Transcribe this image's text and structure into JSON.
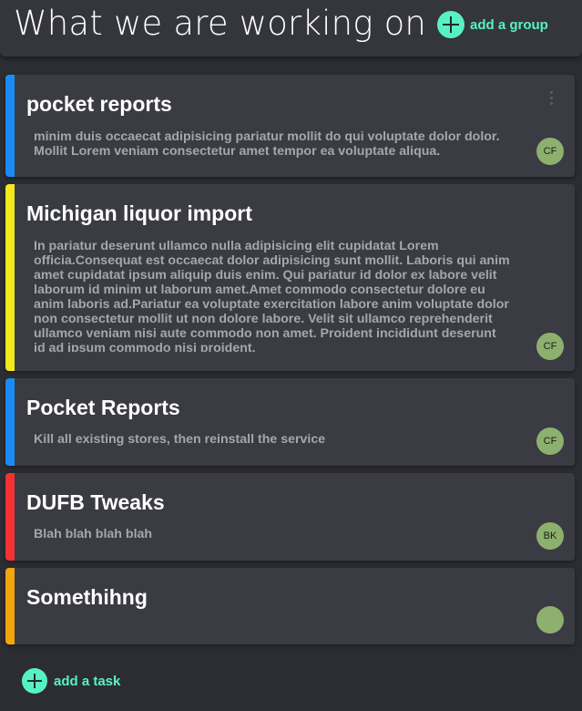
{
  "header": {
    "title": "What we are working on",
    "add_group_label": "add a group"
  },
  "tasks": [
    {
      "title": "pocket reports",
      "description": "minim duis occaecat adipisicing pariatur mollit do qui voluptate dolor dolor. Mollit Lorem veniam consectetur amet tempor ea voluptate aliqua.",
      "assignee": "CF",
      "stripe_color": "#1a8cf5"
    },
    {
      "title": "Michigan liquor import",
      "description": "In pariatur deserunt ullamco nulla adipisicing elit cupidatat Lorem officia.Consequat est occaecat dolor adipisicing sunt mollit. Laboris qui anim amet cupidatat ipsum aliquip duis enim. Qui pariatur id dolor ex labore velit laborum id minim ut laborum amet.Amet commodo consectetur dolore eu anim laboris ad.Pariatur ea voluptate exercitation labore anim voluptate dolor non consectetur mollit ut non dolore labore. Velit sit ullamco reprehenderit ullamco veniam nisi aute commodo non amet. Proident incididunt deserunt id ad ipsum commodo nisi proident.",
      "assignee": "CF",
      "stripe_color": "#f2e91d"
    },
    {
      "title": "Pocket Reports",
      "description": "Kill all existing stores, then reinstall the service",
      "assignee": "CF",
      "stripe_color": "#1a8cf5"
    },
    {
      "title": "DUFB Tweaks",
      "description": "Blah blah blah blah",
      "assignee": "BK",
      "stripe_color": "#f23232"
    },
    {
      "title": "Somethihng",
      "description": "",
      "assignee": "",
      "stripe_color": "#f2a50c"
    }
  ],
  "footer": {
    "add_task_label": "add a task"
  },
  "colors": {
    "accent": "#57f2c3",
    "avatar": "#8db06e",
    "card": "#3a3b43",
    "background": "#2c2d33"
  },
  "icons": {
    "add": "plus-circle-icon",
    "menu": "more-vertical-icon"
  }
}
